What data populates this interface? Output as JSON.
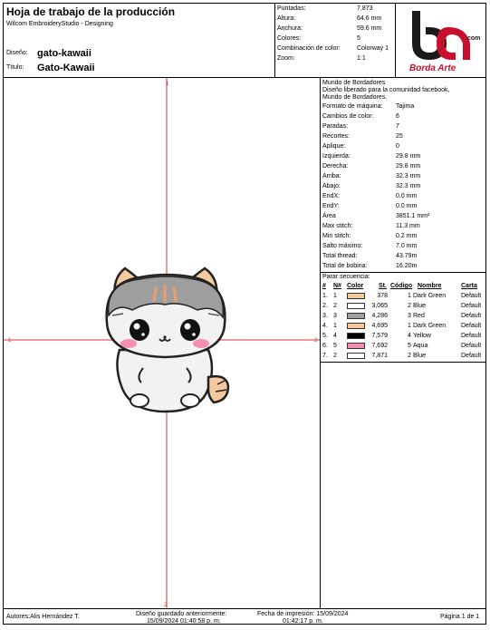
{
  "header": {
    "title": "Hoja de trabajo de la producción",
    "software": "Wilcom EmbroideryStudio - Designing",
    "design_label": "Diseño:",
    "design_value": "gato-kawaii",
    "title_label": "Título:",
    "title_value": "Gato-Kawaii"
  },
  "summary": [
    {
      "k": "Puntadas:",
      "v": "7,873"
    },
    {
      "k": "Altura:",
      "v": "64.6 mm"
    },
    {
      "k": "Anchura:",
      "v": "59.6 mm"
    },
    {
      "k": "Colores:",
      "v": "5"
    },
    {
      "k": "Combinación de color:",
      "v": "Colorway 1"
    },
    {
      "k": "Zoom:",
      "v": "1:1"
    }
  ],
  "logo": {
    "text": "Borda Arte",
    "sub": ".com",
    "color": "#c8102e"
  },
  "canvas": {
    "axis_top": "1",
    "axis_left": "1",
    "axis_right": "2",
    "axis_bottom": "2"
  },
  "info": {
    "notes": [
      "Mundo de Bordadores",
      "Diseño liberado para la comunidad facebook,",
      "Mundo de Bordadores."
    ],
    "props": [
      {
        "k": "Formato de máquina:",
        "v": "Tajima"
      },
      {
        "k": "Cambios de color:",
        "v": "6"
      },
      {
        "k": "Paradas:",
        "v": "7"
      },
      {
        "k": "Recortes:",
        "v": "25"
      },
      {
        "k": "Aplique:",
        "v": "0"
      },
      {
        "k": "Izquierda:",
        "v": "29.8 mm"
      },
      {
        "k": "Derecha:",
        "v": "29.8 mm"
      },
      {
        "k": "Arriba:",
        "v": "32.3 mm"
      },
      {
        "k": "Abajo:",
        "v": "32.3 mm"
      },
      {
        "k": "EndX:",
        "v": "0.0 mm"
      },
      {
        "k": "EndY:",
        "v": "0.0 mm"
      },
      {
        "k": "Área",
        "v": "3851.1 mm²"
      },
      {
        "k": "Max stitch:",
        "v": "11.3 mm"
      },
      {
        "k": "Min stitch:",
        "v": "0.2 mm"
      },
      {
        "k": "Salto máximo:",
        "v": "7.0 mm"
      },
      {
        "k": "Total thread:",
        "v": "43.79m"
      },
      {
        "k": "Total de bobina:",
        "v": "16.20m"
      }
    ],
    "seq_title": "Parar secuencia:",
    "seq_headers": {
      "n": "#",
      "nn": "N#",
      "color": "Color",
      "st": "St.",
      "code": "Código",
      "name": "Nombre",
      "chart": "Carta"
    },
    "seq_rows": [
      {
        "n": "1.",
        "nn": "1",
        "color": "#f7c79a",
        "st": "378",
        "code": "1",
        "name": "Dark Green",
        "chart": "Default"
      },
      {
        "n": "2.",
        "nn": "2",
        "color": "#ffffff",
        "st": "3,065",
        "code": "2",
        "name": "Blue",
        "chart": "Default"
      },
      {
        "n": "3.",
        "nn": "3",
        "color": "#a0a0a0",
        "st": "4,286",
        "code": "3",
        "name": "Red",
        "chart": "Default"
      },
      {
        "n": "4.",
        "nn": "1",
        "color": "#f7c79a",
        "st": "4,695",
        "code": "1",
        "name": "Dark Green",
        "chart": "Default"
      },
      {
        "n": "5.",
        "nn": "4",
        "color": "#000000",
        "st": "7,579",
        "code": "4",
        "name": "Yellow",
        "chart": "Default"
      },
      {
        "n": "6.",
        "nn": "5",
        "color": "#f48fb1",
        "st": "7,692",
        "code": "5",
        "name": "Aqua",
        "chart": "Default"
      },
      {
        "n": "7.",
        "nn": "2",
        "color": "#ffffff",
        "st": "7,871",
        "code": "2",
        "name": "Blue",
        "chart": "Default"
      }
    ]
  },
  "footer": {
    "authors": "Autores:Alis Hernández T.",
    "saved_label": "Diseño guardado anteriormente:",
    "saved_value": "15/09/2024 01:40:58 p. m.",
    "printed_label": "Fecha de impresión: 15/09/2024",
    "printed_value": "01:42:17 p. m.",
    "page": "Página 1 de 1"
  }
}
